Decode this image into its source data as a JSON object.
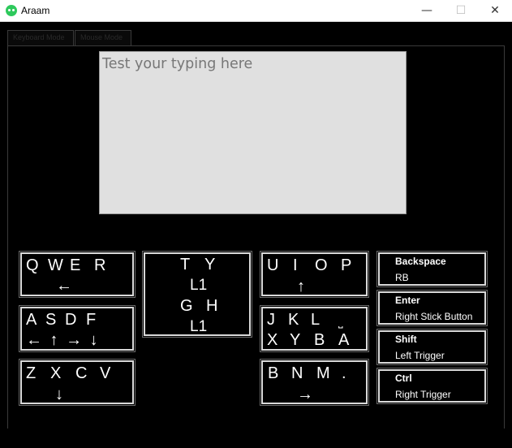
{
  "window": {
    "title": "Araam"
  },
  "tabs": [
    {
      "label": "Keyboard Mode"
    },
    {
      "label": "Mouse Mode"
    }
  ],
  "typing_area": {
    "placeholder": "Test your typing here"
  },
  "key_groups": [
    {
      "name": "group-qwer",
      "rows": [
        "Q W E R",
        "←"
      ]
    },
    {
      "name": "group-asdf",
      "rows": [
        "A S D F",
        "← ↑ → ↓"
      ]
    },
    {
      "name": "group-zxcv",
      "rows": [
        "Z X C V",
        "↓"
      ]
    },
    {
      "name": "group-ty-gh",
      "rows": [
        "T Y",
        "L1",
        "G H",
        "L1"
      ]
    },
    {
      "name": "group-uiop",
      "rows": [
        "U I O P",
        "↑"
      ]
    },
    {
      "name": "group-jkl",
      "rows": [
        "J K L ⎵",
        "X Y B A"
      ]
    },
    {
      "name": "group-bnm",
      "rows": [
        "B N M .",
        "→"
      ]
    }
  ],
  "commands": [
    {
      "title": "Backspace",
      "value": "RB"
    },
    {
      "title": "Enter",
      "value": "Right Stick Button"
    },
    {
      "title": "Shift",
      "value": "Left Trigger"
    },
    {
      "title": "Ctrl",
      "value": "Right Trigger"
    }
  ]
}
